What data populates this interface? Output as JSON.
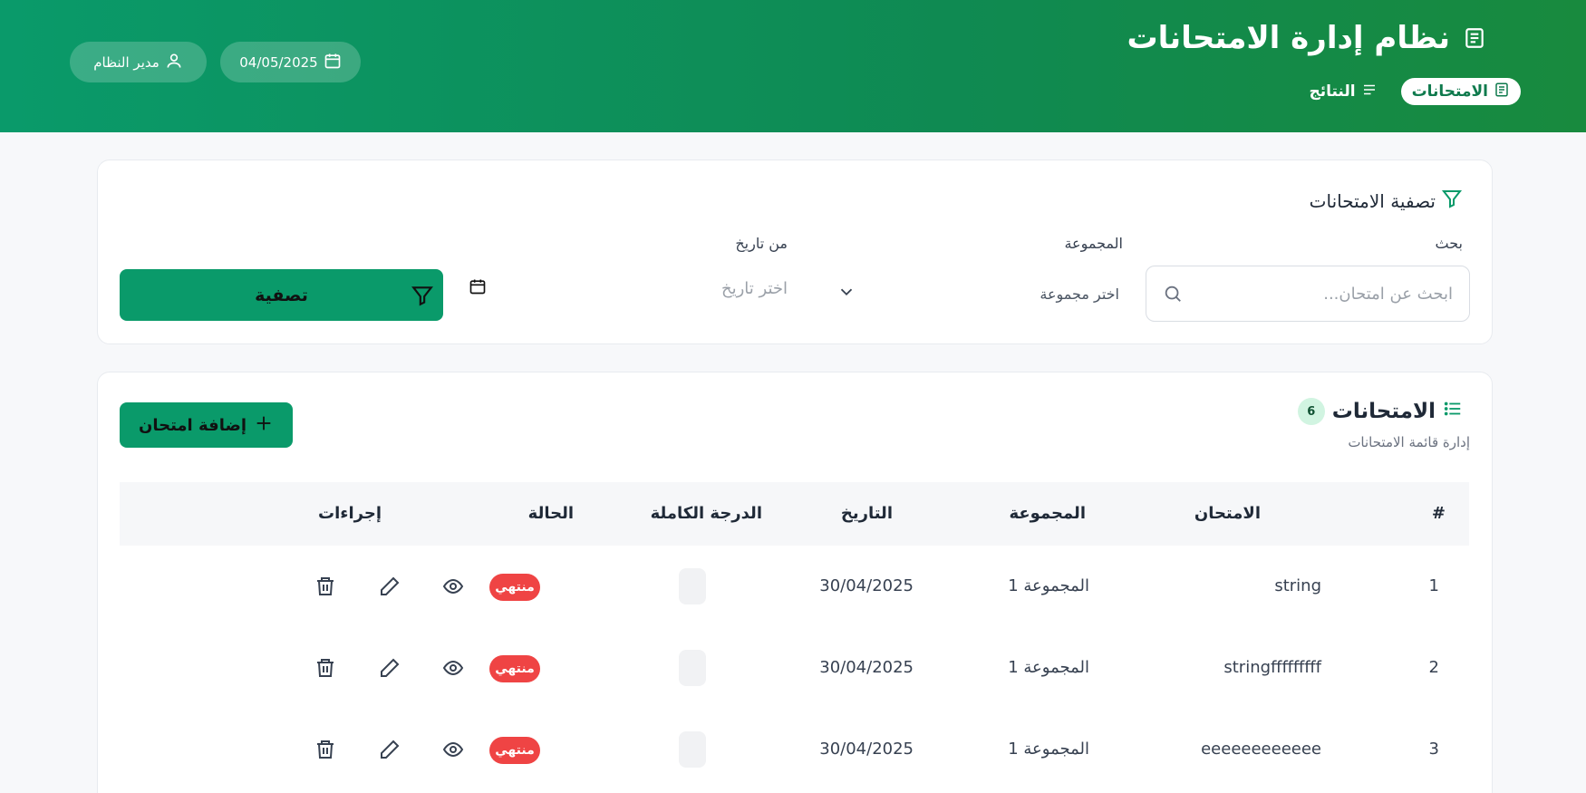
{
  "header": {
    "title": "نظام إدارة الامتحانات",
    "tabs": [
      {
        "label": "الامتحانات",
        "active": true,
        "icon": "document-icon"
      },
      {
        "label": "النتائج",
        "active": false,
        "icon": "list-icon"
      }
    ],
    "date": "04/05/2025",
    "user": "مدير النظام"
  },
  "filters": {
    "title": "تصفية الامتحانات",
    "search_label": "بحث",
    "search_placeholder": "ابحث عن امتحان...",
    "group_label": "المجموعة",
    "group_placeholder": "اختر مجموعة",
    "date_label": "من تاريخ",
    "date_placeholder": "اختر تاريخ",
    "button": "تصفية"
  },
  "exams": {
    "title": "الامتحانات",
    "count": "6",
    "subtitle": "إدارة قائمة الامتحانات",
    "add_button": "إضافة امتحان",
    "columns": {
      "num": "#",
      "exam": "الامتحان",
      "group": "المجموعة",
      "date": "التاريخ",
      "score": "الدرجة الكاملة",
      "status": "الحالة",
      "actions": "إجراءات"
    },
    "rows": [
      {
        "num": "1",
        "exam": "string",
        "group": "المجموعة 1",
        "date": "30/04/2025",
        "status": "منتهي"
      },
      {
        "num": "2",
        "exam": "stringfffffffff",
        "group": "المجموعة 1",
        "date": "30/04/2025",
        "status": "منتهي"
      },
      {
        "num": "3",
        "exam": "eeeeeeeeeeee",
        "group": "المجموعة 1",
        "date": "30/04/2025",
        "status": "منتهي"
      }
    ]
  },
  "colors": {
    "primary": "#0a9a6a",
    "danger": "#ef4444",
    "header_end": "#188a3e"
  }
}
